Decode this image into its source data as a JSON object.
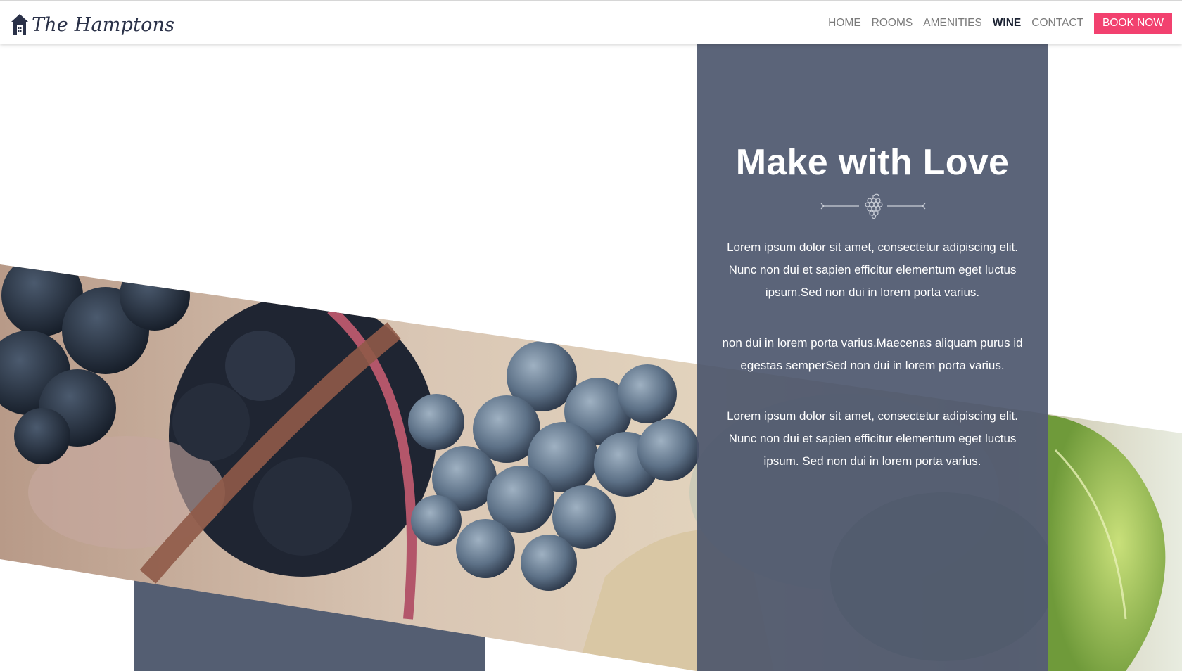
{
  "header": {
    "logo_text": "The Hamptons",
    "nav": [
      {
        "label": "HOME",
        "active": false
      },
      {
        "label": "ROOMS",
        "active": false
      },
      {
        "label": "AMENITIES",
        "active": false
      },
      {
        "label": "WINE",
        "active": true
      },
      {
        "label": "CONTACT",
        "active": false
      }
    ],
    "book_label": "BOOK NOW"
  },
  "panel": {
    "title": "Make with Love",
    "paragraphs": [
      "Lorem ipsum dolor sit amet, consectetur adipiscing elit. Nunc non dui et sapien efficitur elementum eget luctus ipsum.Sed non dui in lorem porta varius.",
      "non dui in lorem porta varius.Maecenas aliquam purus id egestas semperSed non dui in lorem porta varius.",
      "Lorem ipsum dolor sit amet, consectetur adipiscing elit. Nunc non dui et sapien efficitur elementum eget luctus ipsum. Sed non dui in lorem porta varius."
    ]
  },
  "icons": {
    "logo": "house-icon",
    "divider": "grapes-icon",
    "photo": "grapes-photo"
  },
  "colors": {
    "accent": "#f2416f",
    "panel": "#49536a",
    "slate": "#545e72",
    "nav_text": "#7b7b7b",
    "nav_active": "#1c2333"
  }
}
